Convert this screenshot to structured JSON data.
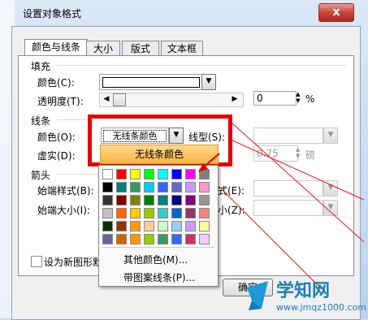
{
  "dialog_title": "设置对象格式",
  "close_label": "x",
  "tabs": [
    "颜色与线条",
    "大小",
    "版式",
    "文本框"
  ],
  "fill": {
    "section": "填充",
    "color_label": "颜色(C):",
    "transparency_label": "透明度(T):",
    "transparency_value": "0",
    "unit": "%"
  },
  "line": {
    "section": "线条",
    "color_label": "颜色(O):",
    "color_value": "无线条颜色",
    "style_label": "线型(S):",
    "dash_label": "虚实(D):",
    "weight_value": "0.75",
    "weight_unit": "磅"
  },
  "arrow": {
    "section": "箭头",
    "begin_style_label": "始端样式(B):",
    "begin_size_label": "始端大小(I):",
    "end_style_label_fragment": "式(E):",
    "end_size_label_fragment": "小(Z):"
  },
  "popup": {
    "no_color": "无线条颜色",
    "more_colors": "其他颜色(M)...",
    "patterned_lines": "带图案线条(P)...",
    "swatches": [
      "#ffffff",
      "#ff0000",
      "#ffff00",
      "#00ff00",
      "#00ffff",
      "#0000ff",
      "#ff00ff",
      "#808080",
      "#000000",
      "#008080",
      "#339966",
      "#00ccff",
      "#3366ff",
      "#6666cc",
      "#cc99ff",
      "#ff99cc",
      "#333333",
      "#800000",
      "#808000",
      "#008000",
      "#008080",
      "#000080",
      "#800080",
      "#969696",
      "#c0c0c0",
      "#ff6600",
      "#ffcc00",
      "#99cc00",
      "#33cccc",
      "#0066cc",
      "#993366",
      "#ff8080",
      "#003300",
      "#993300",
      "#ff9900",
      "#ffcc99",
      "#ccffcc",
      "#99ccff",
      "#cc99ff",
      "#ffff99",
      "#666699",
      "#cc6600",
      "#ff9900",
      "#99cc00",
      "#339966",
      "#3366ff",
      "#cc3366",
      "#ffccff"
    ]
  },
  "default_checkbox_label": "设为新图形默",
  "ok_button": "确定",
  "watermark": {
    "brand": "学知网",
    "url": "www.jmqz1000.com"
  }
}
